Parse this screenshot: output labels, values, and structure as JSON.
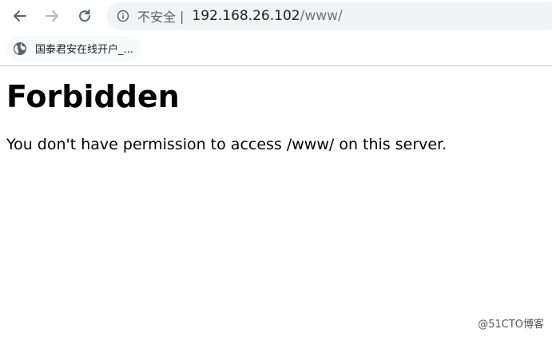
{
  "browser": {
    "security_label": "不安全",
    "separator": "|",
    "url_host": "192.168.26.102",
    "url_path": "/www/",
    "icons": {
      "back": "back-arrow-icon",
      "forward": "forward-arrow-icon",
      "reload": "reload-icon",
      "info": "info-icon"
    },
    "colors": {
      "omnibox_bg": "#f1f3f4",
      "muted_text": "#5f6368"
    }
  },
  "bookmarks": {
    "items": [
      {
        "label": "国泰君安在线开户_...",
        "icon": "globe-icon"
      }
    ]
  },
  "page": {
    "heading": "Forbidden",
    "message": "You don't have permission to access /www/ on this server."
  },
  "watermark": {
    "text": "@51CTO博客"
  }
}
